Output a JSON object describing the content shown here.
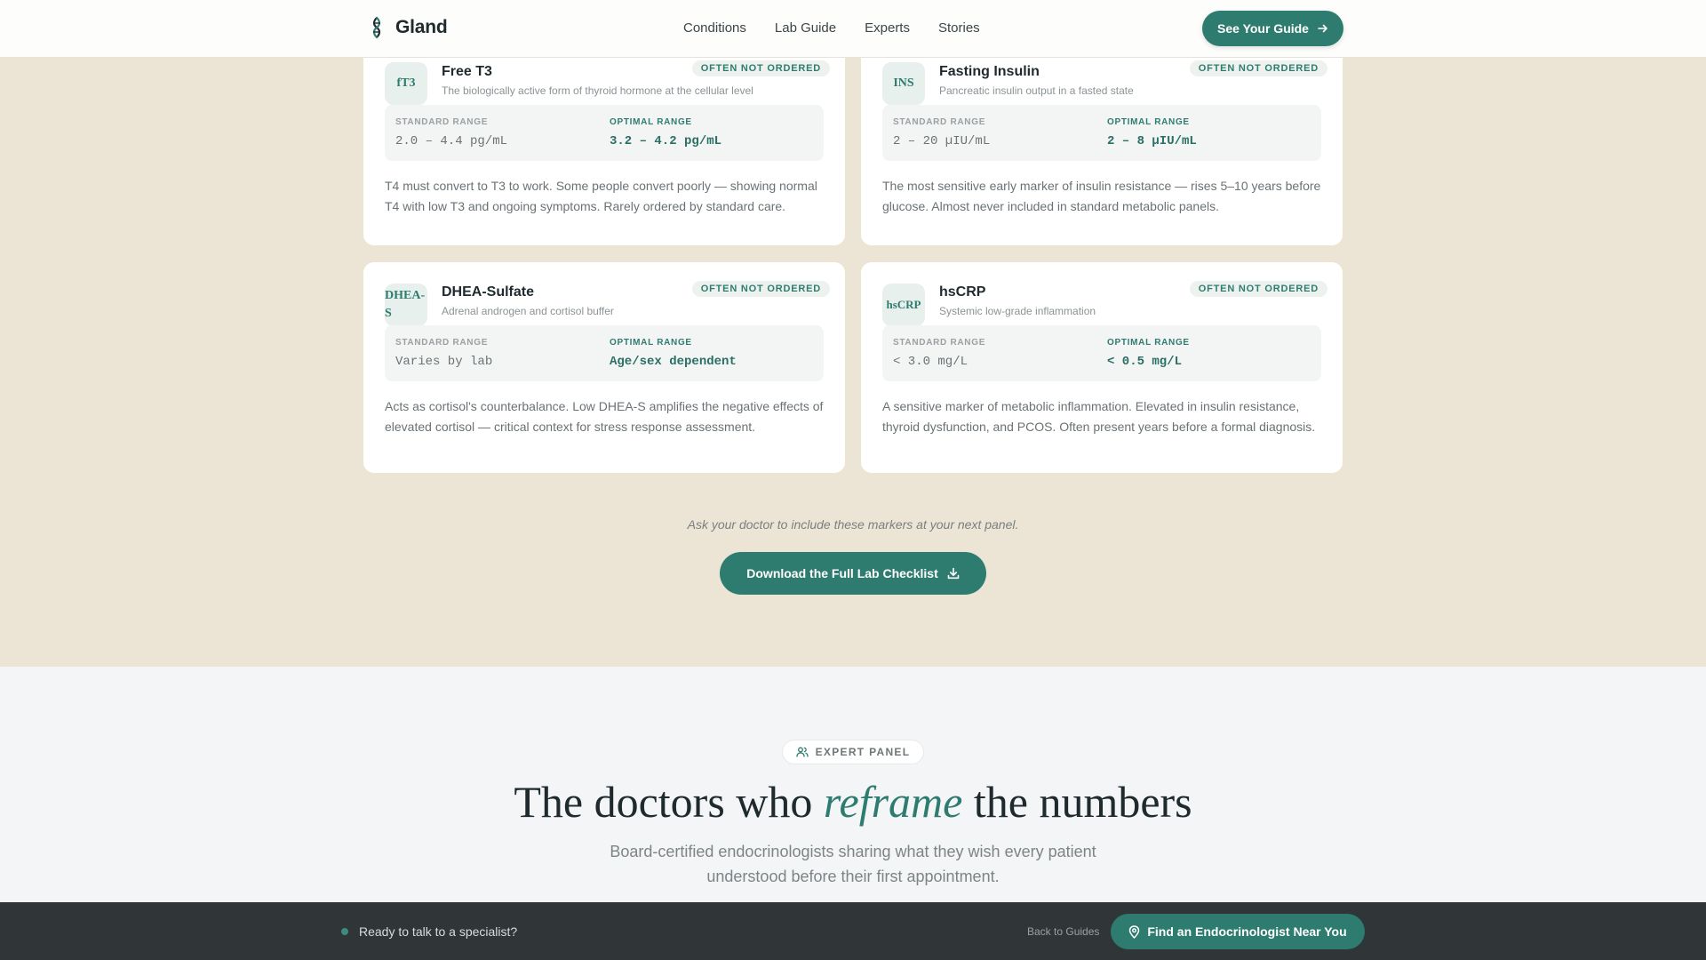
{
  "header": {
    "logo_text": "Gland",
    "nav": [
      "Conditions",
      "Lab Guide",
      "Experts",
      "Stories"
    ],
    "cta_label": "See Your Guide"
  },
  "cards": [
    {
      "code": "fT3",
      "title": "Free T3",
      "subtitle": "The biologically active form of thyroid hormone at the cellular level",
      "badge": "OFTEN NOT ORDERED",
      "standard_label": "STANDARD RANGE",
      "standard_value": "2.0 – 4.4 pg/mL",
      "optimal_label": "OPTIMAL RANGE",
      "optimal_value": "3.2 – 4.2 pg/mL",
      "description": "T4 must convert to T3 to work. Some people convert poorly — showing normal T4 with low T3 and ongoing symptoms. Rarely ordered by standard care."
    },
    {
      "code": "INS",
      "title": "Fasting Insulin",
      "subtitle": "Pancreatic insulin output in a fasted state",
      "badge": "OFTEN NOT ORDERED",
      "standard_label": "STANDARD RANGE",
      "standard_value": "2 – 20 µIU/mL",
      "optimal_label": "OPTIMAL RANGE",
      "optimal_value": "2 – 8 µIU/mL",
      "description": "The most sensitive early marker of insulin resistance — rises 5–10 years before glucose. Almost never included in standard metabolic panels."
    },
    {
      "code": "DHEA-S",
      "title": "DHEA-Sulfate",
      "subtitle": "Adrenal androgen and cortisol buffer",
      "badge": "OFTEN NOT ORDERED",
      "standard_label": "STANDARD RANGE",
      "standard_value": "Varies by lab",
      "optimal_label": "OPTIMAL RANGE",
      "optimal_value": "Age/sex dependent",
      "description": "Acts as cortisol's counterbalance. Low DHEA-S amplifies the negative effects of elevated cortisol — critical context for stress response assessment."
    },
    {
      "code": "hsCRP",
      "title": "hsCRP",
      "subtitle": "Systemic low-grade inflammation",
      "badge": "OFTEN NOT ORDERED",
      "standard_label": "STANDARD RANGE",
      "standard_value": "< 3.0 mg/L",
      "optimal_label": "OPTIMAL RANGE",
      "optimal_value": "< 0.5 mg/L",
      "description": "A sensitive marker of metabolic inflammation. Elevated in insulin resistance, thyroid dysfunction, and PCOS. Often present years before a formal diagnosis."
    }
  ],
  "lab_section": {
    "note": "Ask your doctor to include these markers at your next panel.",
    "download_label": "Download the Full Lab Checklist"
  },
  "expert": {
    "pill_label": "EXPERT PANEL",
    "title_before": "The doctors who ",
    "title_em": "reframe",
    "title_after": " the numbers",
    "subtitle": "Board-certified endocrinologists sharing what they wish every patient understood before their first appointment."
  },
  "bottom_bar": {
    "prompt": "Ready to talk to a specialist?",
    "back_label": "Back to Guides",
    "cta_label": "Find an Endocrinologist Near You"
  },
  "colors": {
    "accent": "#2e7c70",
    "beige": "#ece5d5",
    "dark_bar": "#303538"
  },
  "icons": [
    "logo-icon",
    "arrow-right-icon",
    "download-icon",
    "users-icon",
    "map-pin-icon"
  ]
}
